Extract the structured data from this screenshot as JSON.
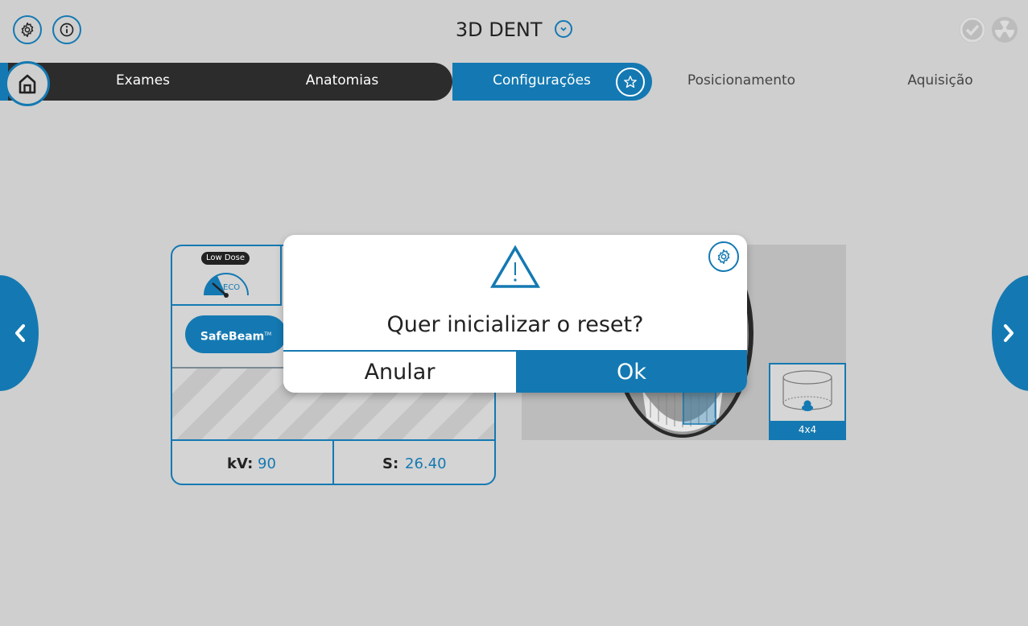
{
  "header": {
    "title": "3D DENT"
  },
  "nav": {
    "tabs": [
      {
        "label": "Exames"
      },
      {
        "label": "Anatomias"
      },
      {
        "label": "Configurações"
      },
      {
        "label": "Posicionamento"
      },
      {
        "label": "Aquisição"
      }
    ]
  },
  "card": {
    "low_dose_badge": "Low Dose",
    "eco_label": "ECO",
    "safebeam_label": "SafeBeam",
    "safebeam_tm": "TM",
    "kv_label": "kV:",
    "kv_value": "90",
    "s_label": "S:",
    "s_value": "26.40"
  },
  "fov": {
    "label": "4x4"
  },
  "dialog": {
    "message": "Quer inicializar o reset?",
    "cancel_label": "Anular",
    "ok_label": "Ok"
  },
  "colors": {
    "accent": "#1479b2",
    "dark_nav": "#2c2c2c",
    "background": "#cfcfcf"
  }
}
